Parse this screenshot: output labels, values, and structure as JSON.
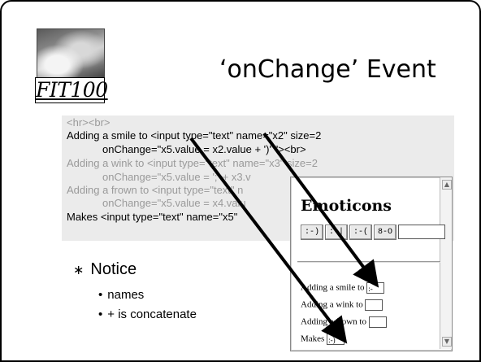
{
  "slide": {
    "logo_text": "FIT100",
    "title": "‘onChange’ Event",
    "code_lines": [
      "<hr><br>",
      "Adding a smile to <input type=\"text\" name=\"x2\" size=2",
      "onChange=\"x5.value = x2.value + ')' \"><br>",
      "Adding a wink to <input type=\"text\" name=\"x3\" size=2",
      "onChange=\"x5.value = ';' + x3.v",
      "Adding a frown to <input type=\"text\" n",
      "onChange=\"x5.value = x4.valu",
      "Makes <input type=\"text\" name=\"x5\""
    ],
    "bullets": {
      "main": "Notice",
      "sub": [
        "names",
        "+ is concatenate"
      ]
    }
  },
  "browser": {
    "heading": "Emoticons",
    "buttons": [
      ":-)",
      ":-|",
      ":-(",
      "8-O"
    ],
    "rows": [
      {
        "label": "Adding a smile to",
        "value": ":-"
      },
      {
        "label": "Adding a wink to",
        "value": ""
      },
      {
        "label": "Adding a frown to",
        "value": ""
      },
      {
        "label": "Makes",
        "value": ":-)"
      }
    ],
    "textbox_value": ""
  },
  "colors": {
    "code_highlight": "#000000",
    "code_dim": "#9a9a9a",
    "code_bg": "#ebebeb"
  }
}
